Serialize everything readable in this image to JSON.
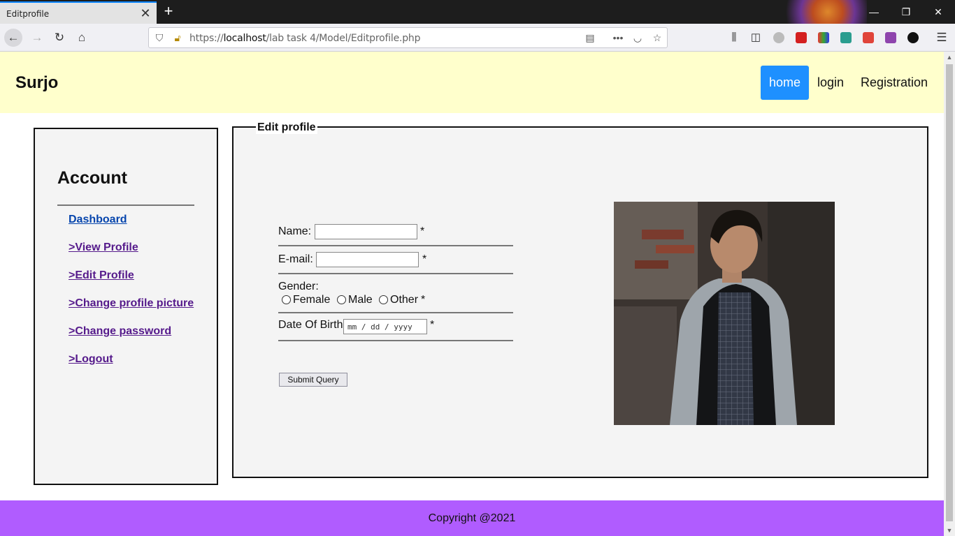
{
  "browser": {
    "tab_title": "Editprofile",
    "url_prefix": "https://",
    "url_host": "localhost",
    "url_path": "/lab task 4/Model/Editprofile.php"
  },
  "header": {
    "brand": "Surjo",
    "menu": [
      {
        "label": "home",
        "active": true
      },
      {
        "label": "login",
        "active": false
      },
      {
        "label": "Registration",
        "active": false
      }
    ]
  },
  "sidebar": {
    "title": "Account",
    "links": [
      {
        "label": "Dashboard"
      },
      {
        "label": ">View Profile"
      },
      {
        "label": ">Edit Profile"
      },
      {
        "label": ">Change profile picture"
      },
      {
        "label": ">Change password"
      },
      {
        "label": ">Logout"
      }
    ]
  },
  "form": {
    "legend": "Edit profile",
    "name_label": "Name:",
    "name_value": "",
    "email_label": "E-mail:",
    "email_value": "",
    "required_mark": "*",
    "gender_label": "Gender:",
    "gender_options": [
      "Female",
      "Male",
      "Other"
    ],
    "dob_label": "Date Of Birth",
    "dob_placeholder": "mm / dd / yyyy",
    "submit_label": "Submit Query"
  },
  "footer": {
    "text": "Copyright @2021"
  },
  "colors": {
    "header_bg": "#ffffcc",
    "active_nav": "#1e90ff",
    "footer_bg": "#b05cff"
  }
}
